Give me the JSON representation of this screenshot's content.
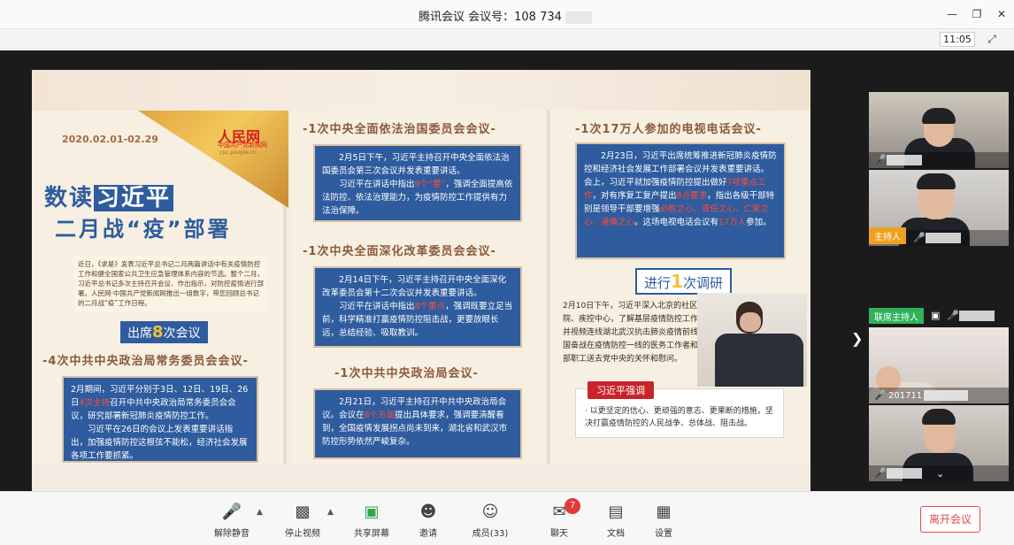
{
  "window": {
    "title": "腾讯会议 会议号：108 734",
    "clock": "11:05",
    "minimize_icon": "minimize-icon",
    "restore_icon": "restore-icon",
    "close_icon": "close-icon",
    "fullscreen_icon": "fullscreen-icon"
  },
  "slide": {
    "date": "2020.02.01-02.29",
    "logo": "人民网",
    "logo_sub": "中国共产党新闻网",
    "logo_url": "cpc.people.cn",
    "headline_1a": "数读",
    "headline_1b": "习近平",
    "headline_2": "二月战“疫”部署",
    "intro": "近日，《求是》发表习近平总书记二月两篇讲话中有关疫情防控工作和健全国家公共卫生应急管理体系内容的节选。整个二月，习近平总书记多次主持召开会议、作出指示，对防控疫情进行部署。人民网·中国共产党新闻网推出一组数字，带您回顾总书记的二月战“疫”工作日程。",
    "meetings_label_a": "出席",
    "meetings_num": "8",
    "meetings_label_b": "次会议",
    "section_politburo_standing": "-4次中共中央政治局常务委员会会议-",
    "box_politburo_standing": {
      "p1_a": "2月期间，习近平分别于3日、12日、19日、26日",
      "p1_hl": "4次主持",
      "p1_b": "召开中共中央政治局常务委员会会议，研究部署新冠肺炎疫情防控工作。",
      "p2": "习近平在26日的会议上发表重要讲话指出，加强疫情防控这根弦不能松，经济社会发展各项工作要抓紧。"
    },
    "section_law": "-1次中央全面依法治国委员会会议-",
    "box_law": {
      "p1": "2月5日下午，习近平主持召开中央全面依法治国委员会第三次会议并发表重要讲话。",
      "p2_a": "习近平在讲话中指出",
      "p2_hl": "9个“要”",
      "p2_b": "，强调全面提高依法防控、依法治理能力，为疫情防控工作提供有力法治保障。"
    },
    "section_reform": "-1次中央全面深化改革委员会会议-",
    "box_reform": {
      "p1": "2月14日下午，习近平主持召开中央全面深化改革委员会第十二次会议并发表重要讲话。",
      "p2_a": "习近平在讲话中指出",
      "p2_hl": "8个重点",
      "p2_b": "，强调既要立足当前，科学精准打赢疫情防控阻击战，更要放眼长远，总结经验、吸取教训。"
    },
    "section_politburo": "-1次中共中央政治局会议-",
    "box_politburo": {
      "p1_a": "2月21日，习近平主持召开中共中央政治局会议。会议在",
      "p1_hl": "8个方面",
      "p1_b": "提出具体要求，强调要清醒看到，全国疫情发展拐点尚未到来，湖北省和武汉市防控形势依然严峻复杂。"
    },
    "section_tv": "-1次17万人参加的电视电话会议-",
    "box_tv": {
      "p1_a": "2月23日，习近平出席统筹推进新冠肺炎疫情防控和经济社会发展工作部署会议并发表重要讲话。会上，习近平就加强疫情防控提出做好",
      "p1_hl1": "7项重点工作",
      "p1_b": "，对有序复工复产提出",
      "p1_hl2": "8点要求",
      "p1_c": "，指出各级干部特别是领导干部要增强",
      "p1_hl3": "必胜之心、责任之心、仁爱之心、谨慎之心",
      "p1_d": "。这场电视电话会议有",
      "p1_hl4": "17万人",
      "p1_e": "参加。"
    },
    "research_a": "进行",
    "research_num": "1",
    "research_b": "次调研",
    "research_text": "2月10日下午，习近平深入北京的社区、医院、疾控中心，了解基层疫情防控工作情况，并视频连线湖北武汉抗击肺炎疫情前线，给全国奋战在疫情防控一线的医务工作者和广大干部职工送去党中央的关怀和慰问。",
    "stress_tag": "习近平强调",
    "stress_text": "· 以更坚定的信心、更顽强的意志、更果断的措施，坚决打赢疫情防控的人民战争、总体战、阻击战。"
  },
  "participants": {
    "host_label": "主持人",
    "cohost_label": "联席主持人",
    "tile4_name": "201711"
  },
  "toolbar": {
    "unmute": "解除静音",
    "stop_video": "停止视频",
    "share_screen": "共享屏幕",
    "invite": "邀请",
    "members": "成员(33)",
    "chat": "聊天",
    "chat_badge": "7",
    "docs": "文档",
    "settings": "设置",
    "leave": "离开会议"
  }
}
